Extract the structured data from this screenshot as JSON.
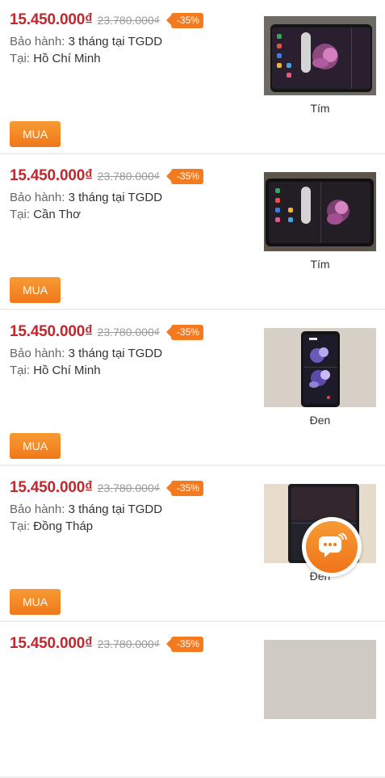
{
  "products": [
    {
      "price": "15.450.000₫",
      "old_price": "23.780.000₫",
      "discount": "-35%",
      "warranty_label": "Bảo hành:",
      "warranty_value": "3 tháng tại TGDD",
      "location_label": "Tại:",
      "location_value": "Hồ Chí Minh",
      "buy_label": "MUA",
      "color": "Tím",
      "image": "phone-open-purple-wallpaper"
    },
    {
      "price": "15.450.000₫",
      "old_price": "23.780.000₫",
      "discount": "-35%",
      "warranty_label": "Bảo hành:",
      "warranty_value": "3 tháng tại TGDD",
      "location_label": "Tại:",
      "location_value": "Cần Thơ",
      "buy_label": "MUA",
      "color": "Tím",
      "image": "phone-open-purple-wallpaper"
    },
    {
      "price": "15.450.000₫",
      "old_price": "23.780.000₫",
      "discount": "-35%",
      "warranty_label": "Bảo hành:",
      "warranty_value": "3 tháng tại TGDD",
      "location_label": "Tại:",
      "location_value": "Hồ Chí Minh",
      "buy_label": "MUA",
      "color": "Đen",
      "image": "phone-open-flower-lockscreen"
    },
    {
      "price": "15.450.000₫",
      "old_price": "23.780.000₫",
      "discount": "-35%",
      "warranty_label": "Bảo hành:",
      "warranty_value": "3 tháng tại TGDD",
      "location_label": "Tại:",
      "location_value": "Đồng Tháp",
      "buy_label": "MUA",
      "color": "Đen",
      "image": "phone-dark-screen"
    },
    {
      "price": "15.450.000₫",
      "old_price": "23.780.000₫",
      "discount": "-35%",
      "image": "phone-partial"
    }
  ],
  "colors": {
    "price": "#c1272d",
    "accent": "#f47a20",
    "button": "#f0781b"
  },
  "chat_button": {
    "icon": "chat-bubbles-icon"
  }
}
